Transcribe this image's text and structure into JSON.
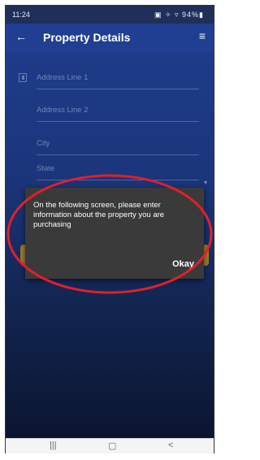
{
  "status_bar": {
    "time": "11:24",
    "icons_text": "▣ ✧ ▿ 94%▮"
  },
  "app_bar": {
    "title": "Property Details",
    "back_icon": "arrow-left-icon",
    "menu_icon": "hamburger-menu-icon"
  },
  "form": {
    "fields": [
      {
        "placeholder": "Address Line 1"
      },
      {
        "placeholder": "Address Line 2"
      },
      {
        "placeholder": "City"
      },
      {
        "placeholder": "State"
      }
    ]
  },
  "dialog": {
    "message": "On the following screen, please enter information about the property you are purchasing",
    "okay_label": "Okay"
  },
  "nav_bar": {
    "recents": "|||",
    "home": "▢",
    "back": "<"
  },
  "colors": {
    "annotation": "#e0202a",
    "dialog_bg": "#3a3a3a",
    "app_bar": "#203f93",
    "button": "#9a7b2a"
  }
}
